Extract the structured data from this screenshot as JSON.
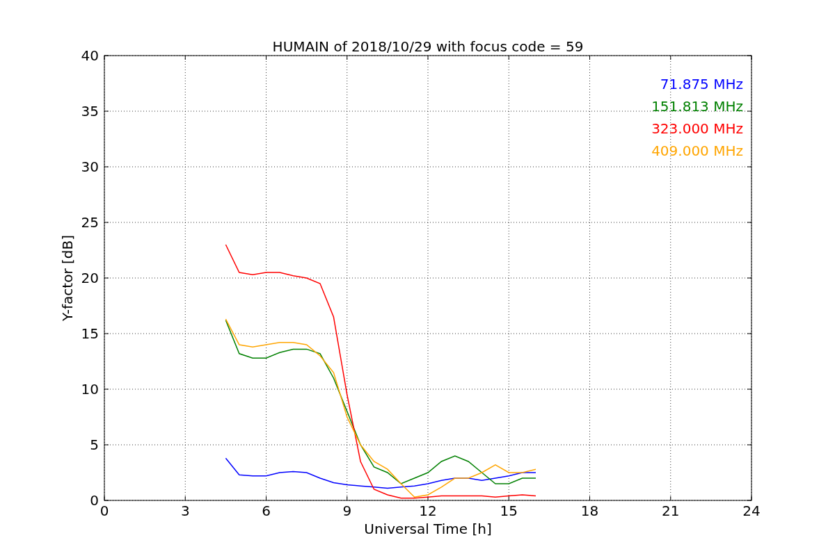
{
  "figure": {
    "chart_data": {
      "type": "line",
      "title": "HUMAIN of 2018/10/29 with focus code = 59",
      "xlabel": "Universal Time [h]",
      "ylabel": "Y-factor [dB]",
      "x": [
        4.5,
        5,
        5.5,
        6,
        6.5,
        7,
        7.5,
        8,
        8.5,
        9,
        9.5,
        10,
        10.5,
        11,
        11.5,
        12,
        12.5,
        13,
        13.5,
        14,
        14.5,
        15,
        15.5,
        16
      ],
      "series": [
        {
          "name": "71.875 MHz",
          "color": "#0000ff",
          "values": [
            3.8,
            2.3,
            2.2,
            2.2,
            2.5,
            2.6,
            2.5,
            2.0,
            1.6,
            1.4,
            1.3,
            1.2,
            1.1,
            1.2,
            1.3,
            1.5,
            1.8,
            2.0,
            2.0,
            1.8,
            2.0,
            2.2,
            2.5,
            2.5
          ]
        },
        {
          "name": "151.813 MHz",
          "color": "#008000",
          "values": [
            16.2,
            13.2,
            12.8,
            12.8,
            13.3,
            13.6,
            13.6,
            13.2,
            11.0,
            8,
            5,
            3,
            2.5,
            1.5,
            2,
            2.5,
            3.5,
            4,
            3.5,
            2.5,
            1.5,
            1.5,
            2,
            2
          ]
        },
        {
          "name": "323.000 MHz",
          "color": "#ff0000",
          "values": [
            23,
            20.5,
            20.3,
            20.5,
            20.5,
            20.2,
            20,
            19.5,
            16.5,
            9.5,
            3.5,
            1,
            0.5,
            0.2,
            0.2,
            0.3,
            0.4,
            0.4,
            0.4,
            0.4,
            0.3,
            0.4,
            0.5,
            0.4
          ]
        },
        {
          "name": "409.000 MHz",
          "color": "#ffa500",
          "values": [
            16.3,
            14,
            13.8,
            14,
            14.2,
            14.2,
            14,
            13,
            11.5,
            7.5,
            5,
            3.5,
            2.8,
            1.5,
            0.3,
            0.5,
            1.2,
            2,
            2,
            2.5,
            3.2,
            2.5,
            2.5,
            2.8
          ]
        }
      ],
      "grid": true,
      "xlim": [
        0,
        24
      ],
      "ylim": [
        0,
        40
      ],
      "xticks": [
        0,
        3,
        6,
        9,
        12,
        15,
        18,
        21,
        24
      ],
      "yticks": [
        0,
        5,
        10,
        15,
        20,
        25,
        30,
        35,
        40
      ]
    }
  }
}
